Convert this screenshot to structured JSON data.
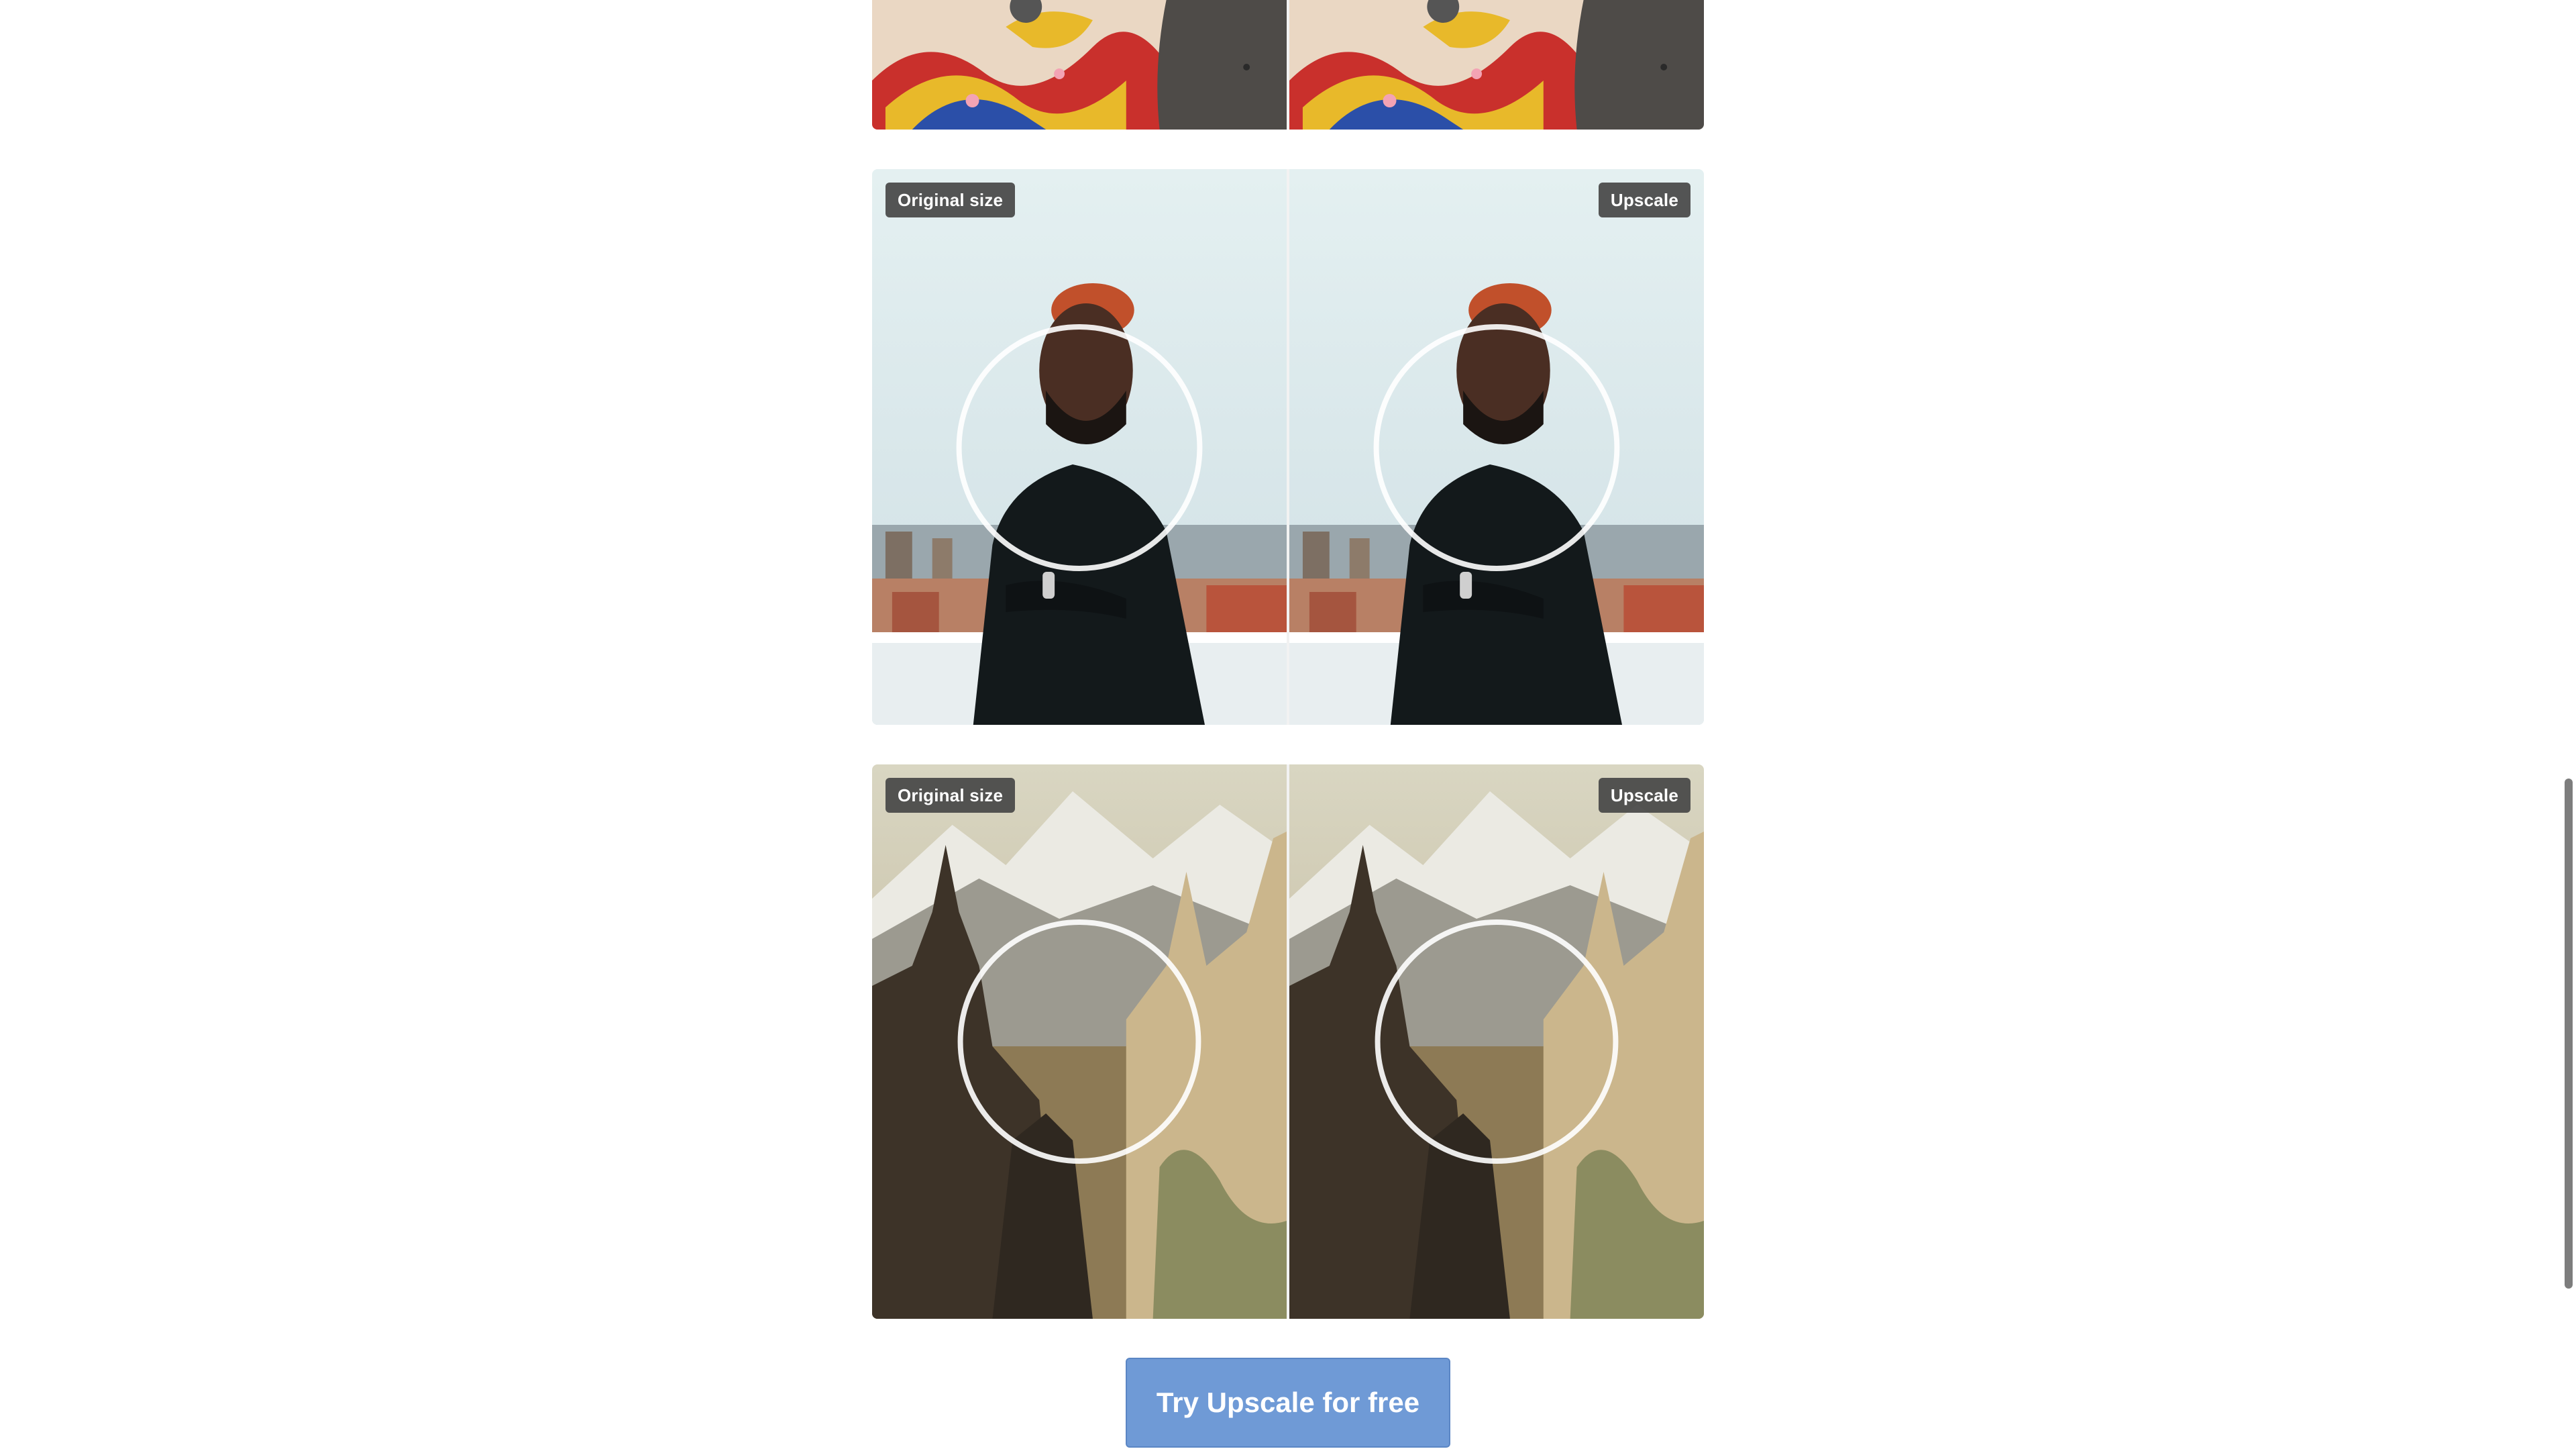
{
  "comparisons": [
    {
      "name": "scarves",
      "left_label": "",
      "right_label": ""
    },
    {
      "name": "portrait",
      "left_label": "Original size",
      "right_label": "Upscale"
    },
    {
      "name": "castle",
      "left_label": "Original size",
      "right_label": "Upscale"
    }
  ],
  "cta": {
    "label": "Try Upscale for free"
  },
  "colors": {
    "cta_background": "#6f9ad6",
    "badge_background": "#464646",
    "page_background": "#ffffff"
  }
}
